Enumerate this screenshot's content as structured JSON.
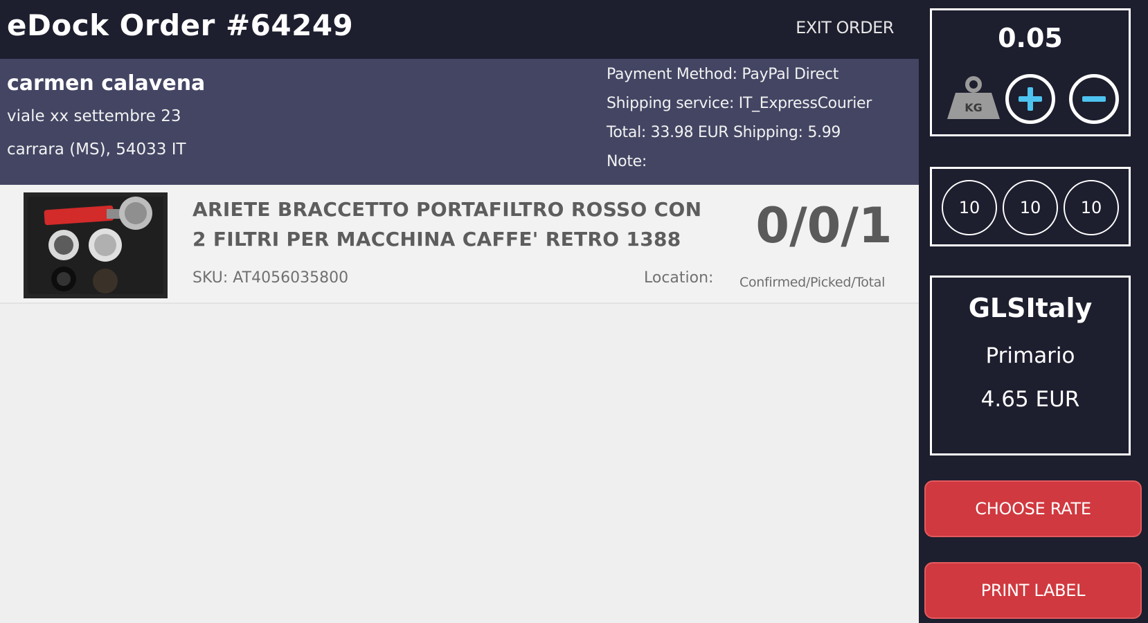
{
  "header": {
    "title": "eDock Order #64249",
    "exit_label": "EXIT ORDER"
  },
  "customer": {
    "name": "carmen calavena",
    "address_line1": "viale xx settembre 23",
    "address_line2": "carrara (MS), 54033 IT",
    "payment_method": "Payment Method: PayPal Direct",
    "shipping_service": "Shipping service: IT_ExpressCourier",
    "totals": "Total: 33.98 EUR Shipping: 5.99",
    "note": "Note:"
  },
  "items": [
    {
      "title": "ARIETE BRACCETTO PORTAFILTRO ROSSO CON 2 FILTRI PER MACCHINA CAFFE' RETRO 1388",
      "sku": "SKU: AT4056035800",
      "location_label": "Location:",
      "quantity": "0/0/1",
      "quantity_caption": "Confirmed/Picked/Total"
    }
  ],
  "side": {
    "weight": "0.05",
    "weight_icon": "kg-weight-icon",
    "weight_unit": "KG",
    "dimensions": [
      "10",
      "10",
      "10"
    ],
    "carrier": "GLSItaly",
    "service": "Primario",
    "price": "4.65 EUR",
    "choose_rate_label": "CHOOSE RATE",
    "print_label_label": "PRINT LABEL"
  },
  "colors": {
    "dark_bg": "#1d1e2e",
    "customer_bg": "#434563",
    "button_red": "#d0393f",
    "plus_accent": "#4ec3ef"
  }
}
